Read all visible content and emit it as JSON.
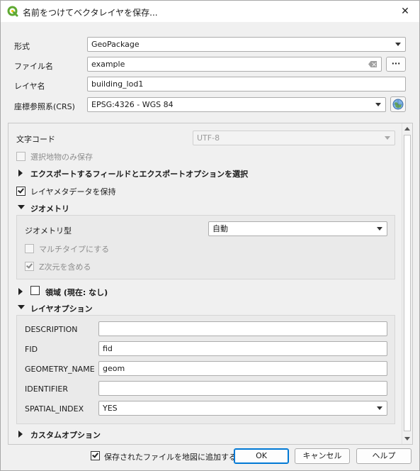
{
  "window": {
    "title": "名前をつけてベクタレイヤを保存..."
  },
  "colors": {
    "accent": "#0078d4",
    "qgis_green": "#5fa932",
    "background": "#f0f0f0"
  },
  "form": {
    "format_label": "形式",
    "format_value": "GeoPackage",
    "filename_label": "ファイル名",
    "filename_value": "example",
    "browse_label": "···",
    "layername_label": "レイヤ名",
    "layername_value": "building_lod1",
    "crs_label": "座標参照系(CRS)",
    "crs_value": "EPSG:4326 - WGS 84"
  },
  "options": {
    "encoding_label": "文字コード",
    "encoding_value": "UTF-8",
    "selected_only_label": "選択地物のみ保存",
    "export_fields_label": "エクスポートするフィールドとエクスポートオプションを選択",
    "keep_metadata_label": "レイヤメタデータを保持",
    "geometry_group_label": "ジオメトリ",
    "geometry_type_label": "ジオメトリ型",
    "geometry_type_value": "自動",
    "multitype_label": "マルチタイプにする",
    "include_z_label": "Z次元を含める",
    "extent_label": "領域 (現在: なし)",
    "layer_options_label": "レイヤオプション",
    "layer_options": [
      {
        "name": "DESCRIPTION",
        "value": ""
      },
      {
        "name": "FID",
        "value": "fid"
      },
      {
        "name": "GEOMETRY_NAME",
        "value": "geom"
      },
      {
        "name": "IDENTIFIER",
        "value": ""
      },
      {
        "name": "SPATIAL_INDEX",
        "value": "YES"
      }
    ],
    "custom_options_label": "カスタムオプション"
  },
  "footer": {
    "add_to_map_label": "保存されたファイルを地図に追加する",
    "ok_label": "OK",
    "cancel_label": "キャンセル",
    "help_label": "ヘルプ"
  }
}
